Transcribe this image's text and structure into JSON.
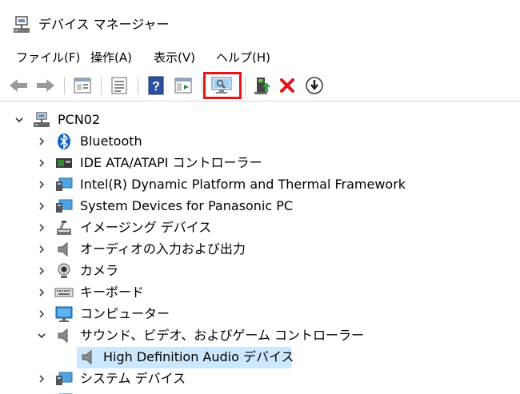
{
  "window": {
    "title": "デバイス マネージャー"
  },
  "menu": [
    {
      "label": "ファイル(F)"
    },
    {
      "label": "操作(A)"
    },
    {
      "label": "表示(V)"
    },
    {
      "label": "ヘルプ(H)"
    }
  ],
  "toolbar": {
    "icons": [
      "back-arrow-icon",
      "forward-arrow-icon",
      "properties-window-icon",
      "device-list-icon",
      "help-icon",
      "show-hide-console-tree-icon",
      "scan-hardware-changes-icon",
      "update-driver-icon",
      "uninstall-device-icon",
      "disable-device-icon"
    ],
    "highlight_color": "#e8141b"
  },
  "tree": {
    "root": "PCN02",
    "items": [
      {
        "label": "Bluetooth"
      },
      {
        "label": "IDE ATA/ATAPI コントローラー"
      },
      {
        "label": "Intel(R) Dynamic Platform and Thermal Framework"
      },
      {
        "label": "System Devices for Panasonic PC"
      },
      {
        "label": "イメージング デバイス"
      },
      {
        "label": "オーディオの入力および出力"
      },
      {
        "label": "カメラ"
      },
      {
        "label": "キーボード"
      },
      {
        "label": "コンピューター"
      },
      {
        "label": "サウンド、ビデオ、およびゲーム コントローラー"
      },
      {
        "label": "High Definition Audio デバイス"
      },
      {
        "label": "システム デバイス"
      }
    ],
    "selection_color": "#cce8ff"
  }
}
